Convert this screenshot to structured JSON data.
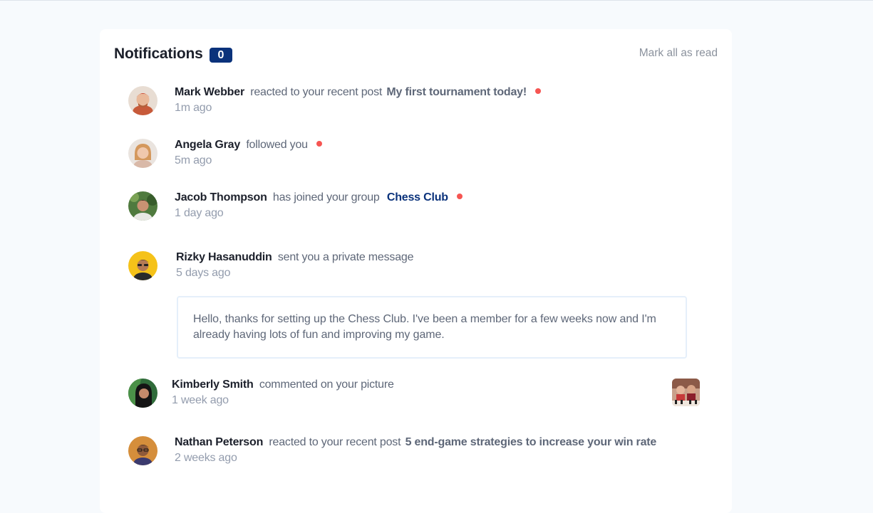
{
  "header": {
    "title": "Notifications",
    "unread_count": "0",
    "mark_all_label": "Mark all as read"
  },
  "notifications": [
    {
      "name": "Mark Webber",
      "action": "reacted to your recent post",
      "target": "My first tournament today!",
      "time": "1m ago",
      "unread": true
    },
    {
      "name": "Angela Gray",
      "action": "followed you",
      "time": "5m ago",
      "unread": true
    },
    {
      "name": "Jacob Thompson",
      "action": "has joined your group",
      "target": "Chess Club",
      "time": "1 day ago",
      "unread": true
    },
    {
      "name": "Rizky Hasanuddin",
      "action": "sent you a private message",
      "time": "5 days ago",
      "message": "Hello, thanks for setting up the Chess Club. I've been a member for a few weeks now and I'm already having lots of fun and improving my game.",
      "unread": false
    },
    {
      "name": "Kimberly Smith",
      "action": "commented on your picture",
      "time": "1 week ago",
      "unread": false
    },
    {
      "name": "Nathan Peterson",
      "action": "reacted to your recent post",
      "target": "5 end-game strategies to increase your win rate",
      "time": "2 weeks ago",
      "unread": false
    }
  ],
  "colors": {
    "accent": "#0a327b",
    "unread_dot": "#f65552",
    "page_bg": "#f7fafd"
  }
}
